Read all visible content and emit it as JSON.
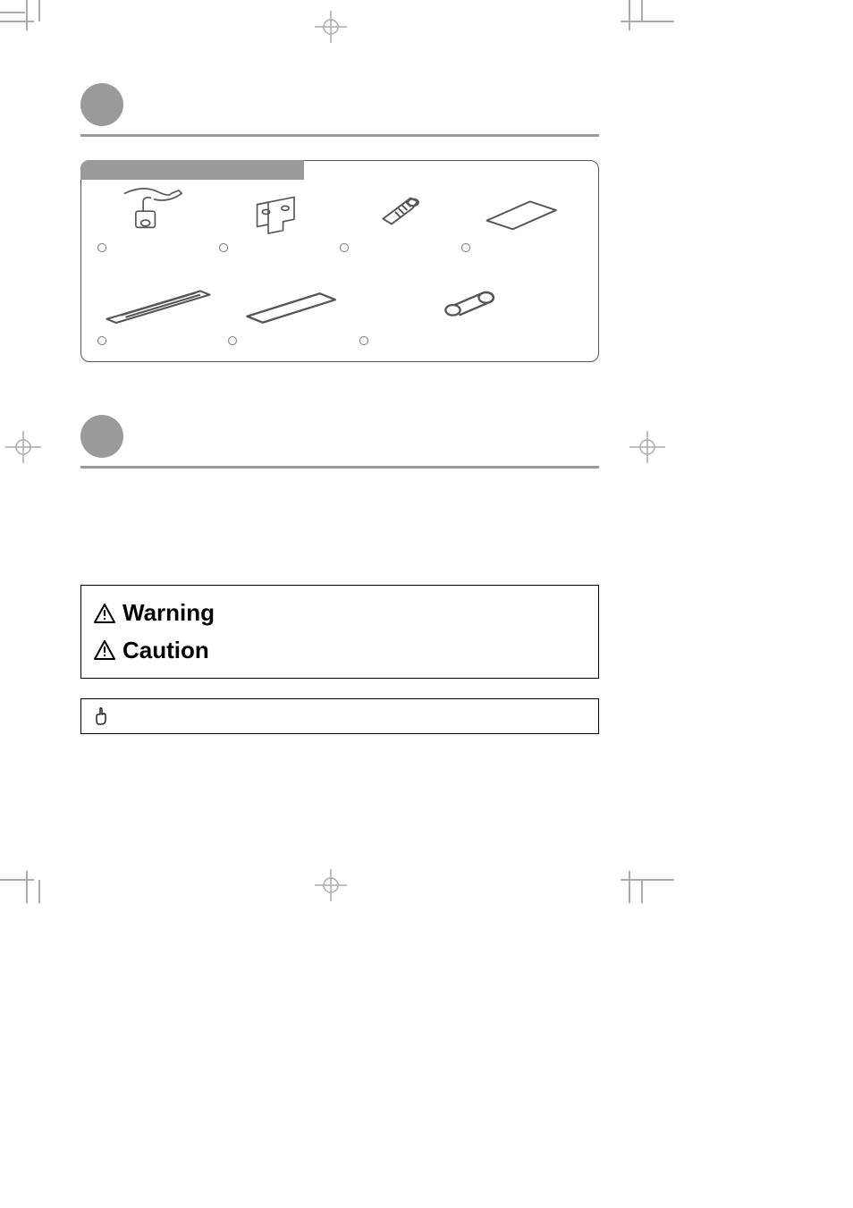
{
  "section1": {
    "title": ""
  },
  "parts": {
    "tab_label": "",
    "row1": [
      {
        "name": "camera-with-cable",
        "label": ""
      },
      {
        "name": "mounting-bracket",
        "label": ""
      },
      {
        "name": "bolt",
        "label": ""
      },
      {
        "name": "sheet",
        "label": ""
      }
    ],
    "row2": [
      {
        "name": "long-strip",
        "label": ""
      },
      {
        "name": "flat-strip",
        "label": ""
      },
      {
        "name": "connector-sleeve",
        "label": ""
      }
    ]
  },
  "section2": {
    "title": ""
  },
  "legend": {
    "warning_label": "Warning",
    "caution_label": "Caution",
    "note_label": ""
  },
  "colors": {
    "grey": "#9a9a9a",
    "line": "#555555"
  }
}
